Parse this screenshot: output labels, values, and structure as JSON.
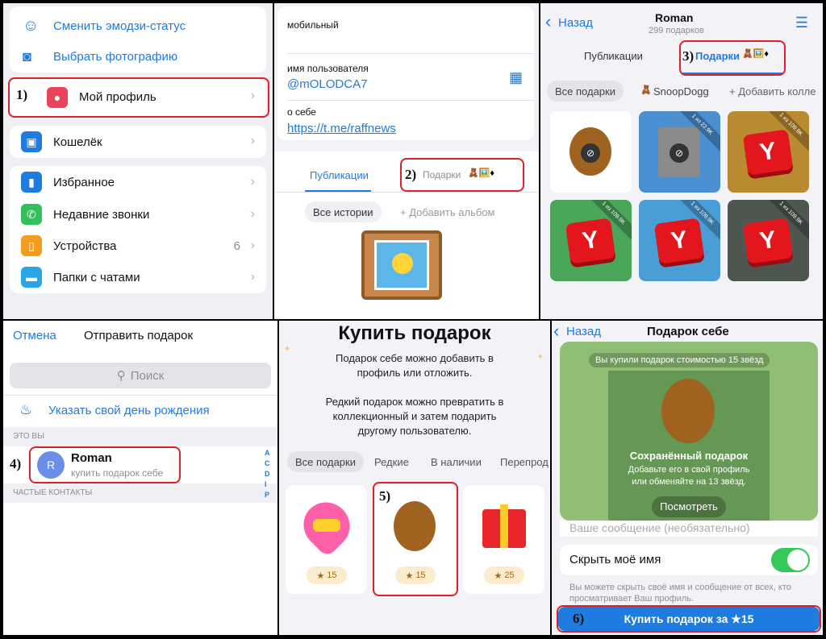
{
  "p1": {
    "top_items": [
      {
        "label": "Сменить эмодзи-статус",
        "icon": "emoji-icon"
      },
      {
        "label": "Выбрать фотографию",
        "icon": "camera-icon"
      }
    ],
    "profile": {
      "label": "Мой профиль",
      "marker": "1)"
    },
    "wallet": {
      "label": "Кошелёк"
    },
    "items": [
      {
        "label": "Избранное",
        "icon": "bookmark-icon",
        "color": "#1e7be0"
      },
      {
        "label": "Недавние звонки",
        "icon": "phone-icon",
        "color": "#33c05a"
      },
      {
        "label": "Устройства",
        "icon": "devices-icon",
        "color": "#f39c1e",
        "count": "6"
      },
      {
        "label": "Папки с чатами",
        "icon": "folder-icon",
        "color": "#29a5e6"
      }
    ]
  },
  "p2": {
    "mobile_label": "мобильный",
    "username_label": "имя пользователя",
    "username": "@mOLODCA7",
    "about_label": "о себе",
    "about_link": "https://t.me/raffnews",
    "tab_publications": "Публикации",
    "tab_gifts": "Подарки",
    "marker": "2)",
    "chip_all": "Все истории",
    "chip_add": "+ Добавить альбом"
  },
  "p3": {
    "back": "Назад",
    "name": "Roman",
    "subtitle": "299 подарков",
    "tab_publications": "Публикации",
    "tab_gifts": "Подарки",
    "marker": "3)",
    "chips": [
      "Все подарки",
      "SnoopDogg",
      "+ Добавить колле"
    ],
    "ribbons": [
      "1 из 22.9K",
      "1 из 109.9K",
      "1 из 109.9K",
      "1 из 109.9K",
      "1 из 109.9K"
    ]
  },
  "p4": {
    "cancel": "Отмена",
    "title": "Отправить подарок",
    "search_placeholder": "Поиск",
    "birthday": "Указать свой день рождения",
    "section_you": "ЭТО ВЫ",
    "contact_name": "Roman",
    "contact_sub": "купить подарок себе",
    "avatar_letter": "R",
    "marker": "4)",
    "section_frequent": "ЧАСТЫЕ КОНТАКТЫ",
    "index": [
      "A",
      "C",
      "D",
      "I",
      "P"
    ]
  },
  "p5": {
    "title": "Купить подарок",
    "desc1": "Подарок себе можно добавить в профиль или отложить.",
    "desc2": "Редкий подарок можно превратить в коллекционный и затем подарить другому пользователю.",
    "chips": [
      "Все подарки",
      "Редкие",
      "В наличии",
      "Перепрод"
    ],
    "prices": [
      "15",
      "15",
      "25"
    ],
    "marker": "5)"
  },
  "p6": {
    "back": "Назад",
    "title": "Подарок себе",
    "banner": "Вы купили подарок стоимостью 15 звёзд",
    "saved_title": "Сохранённый подарок",
    "saved_desc": "Добавьте его в свой профиль или обменяйте на 13 звёзд.",
    "view_button": "Посмотреть",
    "message_placeholder": "Ваше сообщение (необязательно)",
    "hide_name": "Скрыть моё имя",
    "hint": "Вы можете скрыть своё имя и сообщение от всех, кто просматривает Ваш профиль.",
    "buy_button": "Купить подарок за ★15",
    "marker": "6)"
  },
  "colors": {
    "accent": "#1e7be0",
    "red_marker": "#d8232a",
    "toggle_on": "#34c759"
  }
}
